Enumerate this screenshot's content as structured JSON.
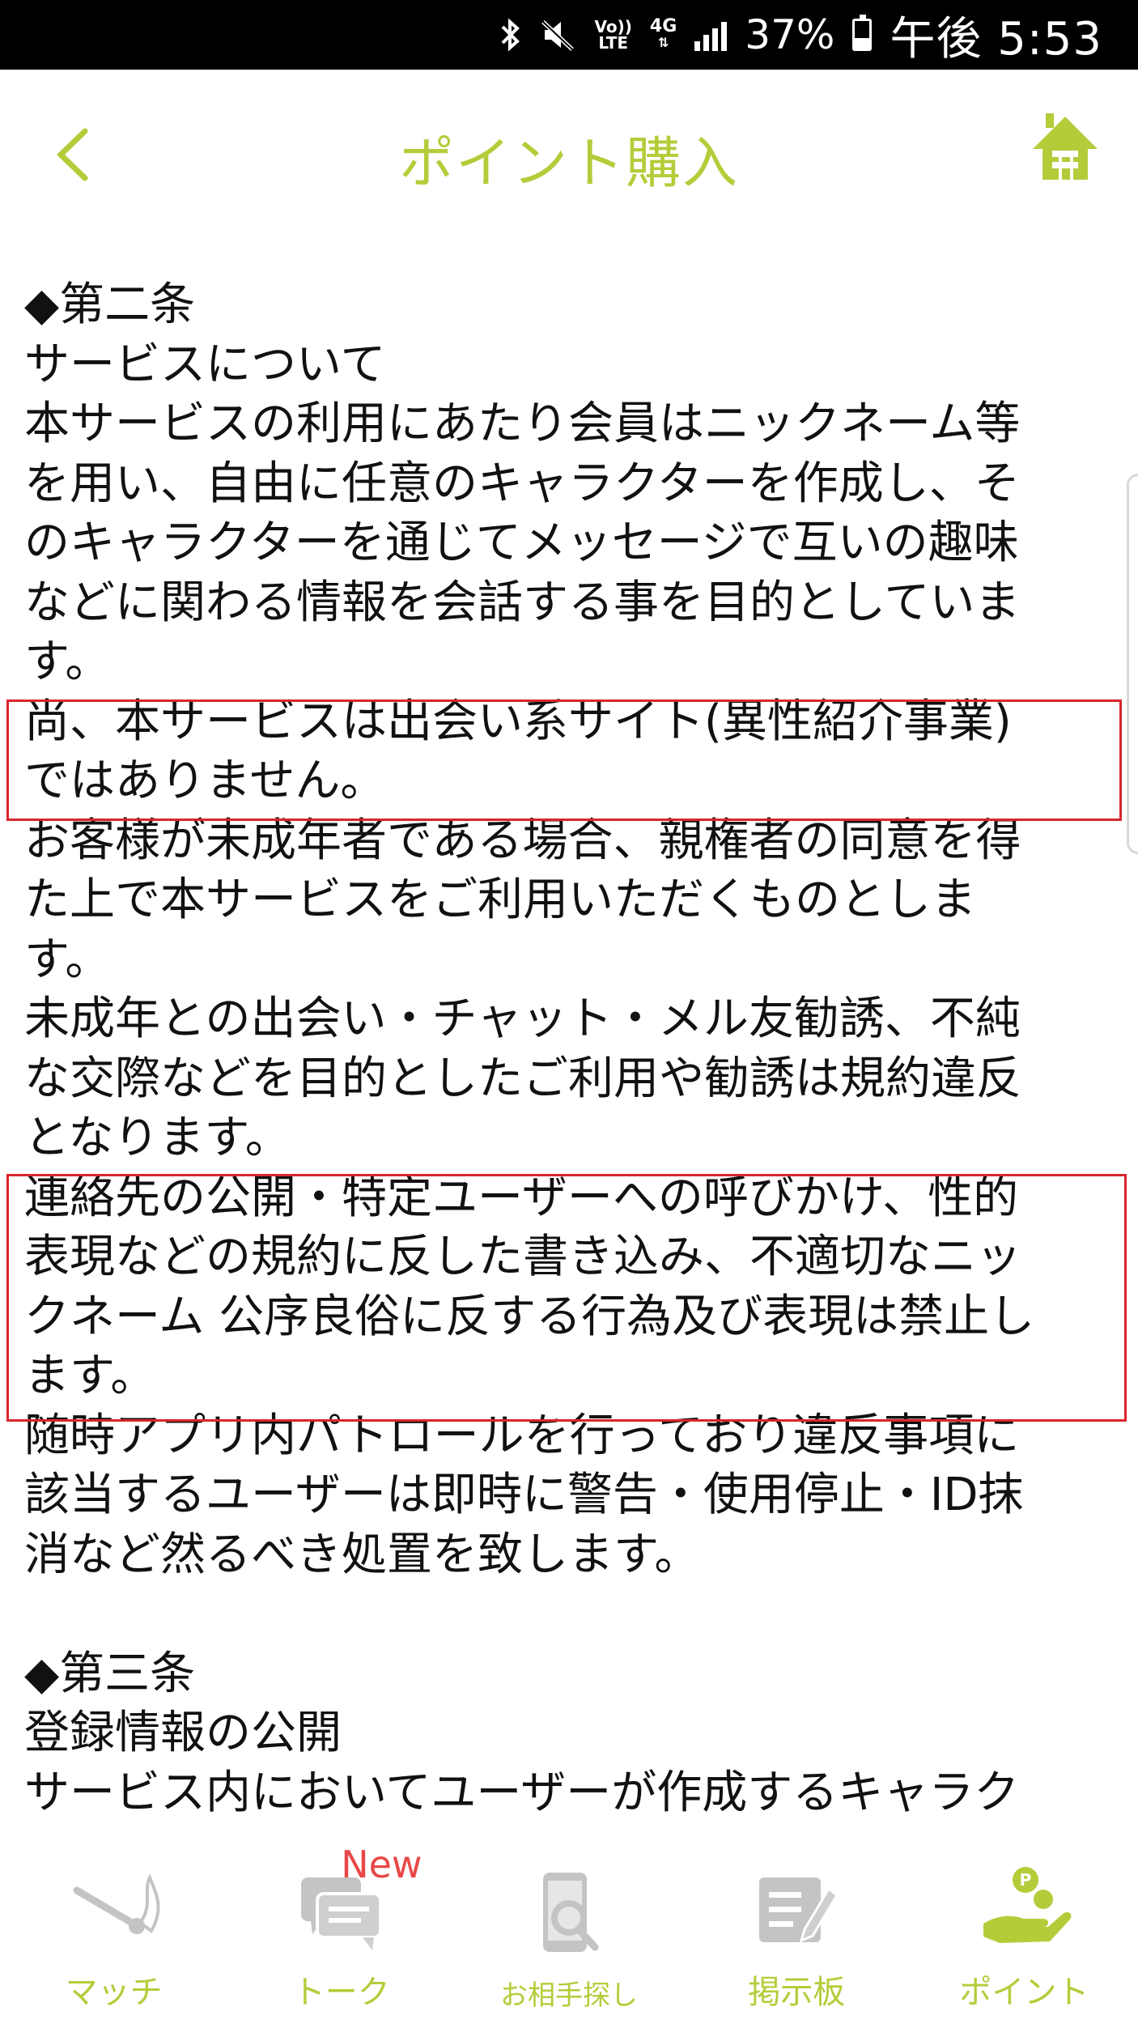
{
  "status_bar": {
    "volte": [
      "Vo))",
      "LTE"
    ],
    "network": "4G",
    "battery_percent": "37%",
    "battery_level": 0.37,
    "time": "午後 5:53"
  },
  "header": {
    "title": "ポイント購入",
    "accent_color": "#b5cc3a"
  },
  "content": {
    "lines": [
      "◆第二条",
      "サービスについて",
      "本サービスの利用にあたり会員はニックネーム等",
      "を用い、自由に任意のキャラクターを作成し、そ",
      "のキャラクターを通じてメッセージで互いの趣味",
      "などに関わる情報を会話する事を目的としていま",
      "す。",
      "尚、本サービスは出会い系サイト(異性紹介事業)",
      "ではありません。",
      "お客様が未成年者である場合、親権者の同意を得",
      "た上で本サービスをご利用いただくものとしま",
      "す。",
      "未成年との出会い・チャット・メル友勧誘、不純",
      "な交際などを目的としたご利用や勧誘は規約違反",
      "となります。",
      "連絡先の公開・特定ユーザーへの呼びかけ、性的",
      "表現などの規約に反した書き込み、不適切なニッ",
      "クネーム 公序良俗に反する行為及び表現は禁止し",
      "ます。",
      "随時アプリ内パトロールを行っており違反事項に",
      "該当するユーザーは即時に警告・使用停止・ID抹",
      "消など然るべき処置を致します。",
      "",
      "◆第三条",
      "登録情報の公開",
      "サービス内においてユーザーが作成するキャラク"
    ],
    "highlight_color": "#d9262e"
  },
  "bottom_nav": {
    "items": [
      {
        "label": "マッチ",
        "icon": "match-icon"
      },
      {
        "label": "トーク",
        "icon": "talk-icon",
        "badge": "New"
      },
      {
        "label": "お相手探し",
        "icon": "partner-search-icon"
      },
      {
        "label": "掲示板",
        "icon": "bulletin-board-icon"
      },
      {
        "label": "ポイント",
        "icon": "point-icon"
      }
    ]
  }
}
